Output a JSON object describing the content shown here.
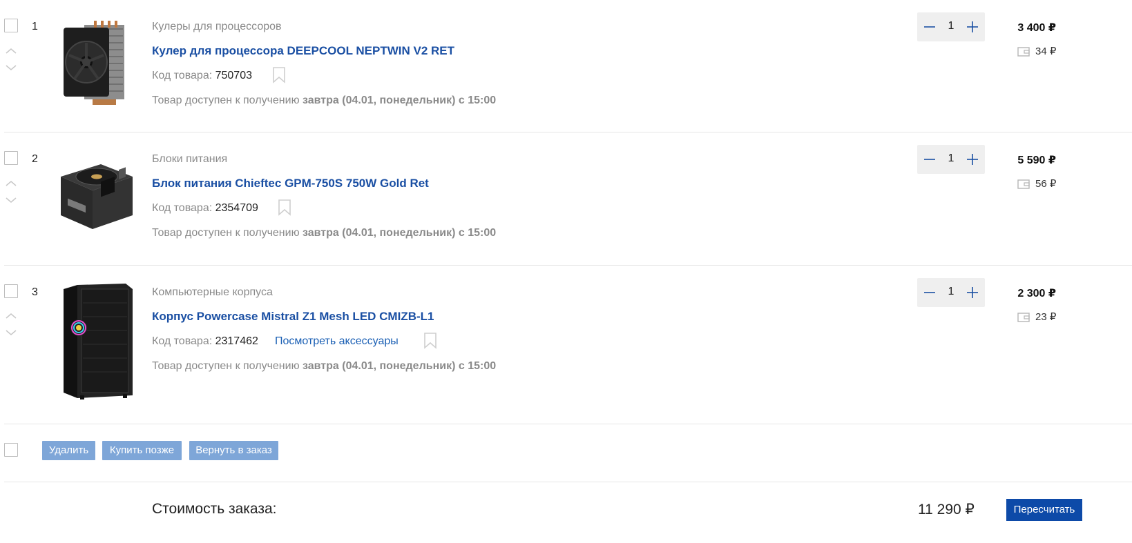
{
  "items": [
    {
      "index": "1",
      "category": "Кулеры для процессоров",
      "title": "Кулер для процессора DEEPCOOL NEPTWIN V2 RET",
      "code_label": "Код товара:",
      "code": "750703",
      "accessories": "",
      "availability_prefix": "Товар доступен к получению",
      "availability_time": "завтра (04.01, понедельник) с 15:00",
      "quantity": "1",
      "price": "3 400 ₽",
      "bonus": "34 ₽",
      "image_icon": "cpu-cooler-image"
    },
    {
      "index": "2",
      "category": "Блоки питания",
      "title": "Блок питания Chieftec GPM-750S 750W Gold Ret",
      "code_label": "Код товара:",
      "code": "2354709",
      "accessories": "",
      "availability_prefix": "Товар доступен к получению",
      "availability_time": "завтра (04.01, понедельник) с 15:00",
      "quantity": "1",
      "price": "5 590 ₽",
      "bonus": "56 ₽",
      "image_icon": "power-supply-image"
    },
    {
      "index": "3",
      "category": "Компьютерные корпуса",
      "title": "Корпус Powercase Mistral Z1 Mesh LED CMIZB-L1",
      "code_label": "Код товара:",
      "code": "2317462",
      "accessories": "Посмотреть аксессуары",
      "availability_prefix": "Товар доступен к получению",
      "availability_time": "завтра (04.01, понедельник) с 15:00",
      "quantity": "1",
      "price": "2 300 ₽",
      "bonus": "23 ₽",
      "image_icon": "pc-case-image"
    }
  ],
  "actions": {
    "delete": "Удалить",
    "buy_later": "Купить позже",
    "return_to_order": "Вернуть в заказ"
  },
  "summary": {
    "label": "Стоимость заказа:",
    "total": "11 290 ₽",
    "recalc": "Пересчитать"
  },
  "colors": {
    "link": "#1a4fa3",
    "button": "#7ea6d8",
    "primary_button": "#0d4aa8",
    "qty_bg": "#efefef"
  }
}
